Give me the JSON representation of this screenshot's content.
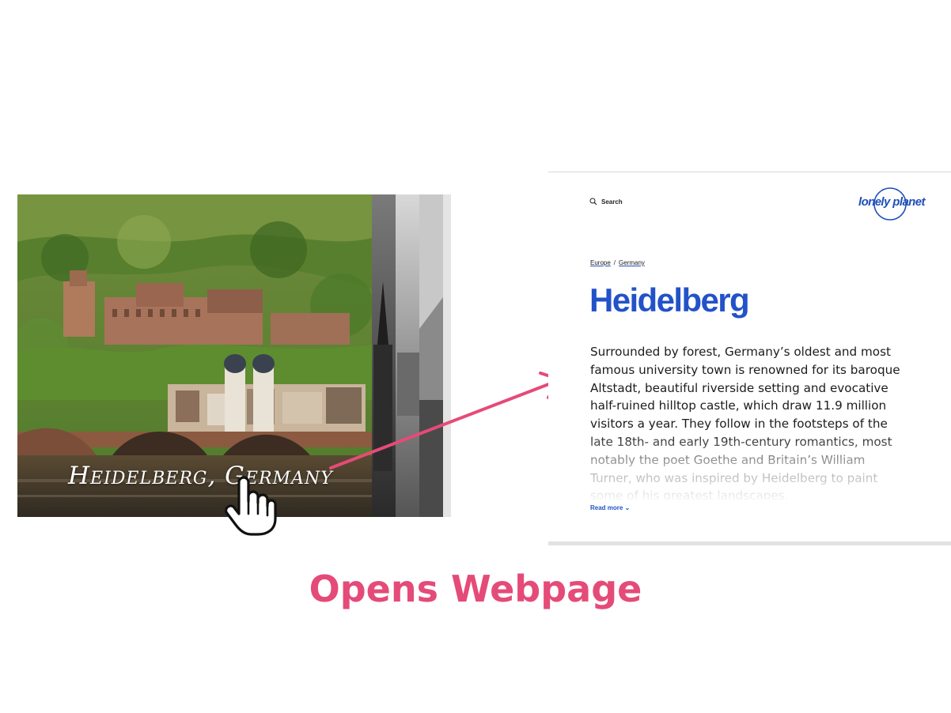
{
  "photo": {
    "caption": "Heidelberg, Germany"
  },
  "webpage": {
    "search_label": "Search",
    "logo_text": "lonely planet",
    "breadcrumb": [
      "Europe",
      "Germany"
    ],
    "breadcrumb_separator": "/",
    "title": "Heidelberg",
    "intro": "Surrounded by forest, Germany’s oldest and most famous university town is renowned for its baroque Altstadt, beautiful riverside setting and evocative half-ruined hilltop castle, which draw 11.9 million visitors a year. They follow in the footsteps of the late 18th- and early 19th-century romantics, most notably the poet Goethe and Britain’s William Turner, who was inspired by Heidelberg to paint some of his greatest landscapes.",
    "read_more": "Read more ⌄"
  },
  "heading": "Opens Webpage",
  "colors": {
    "accent_pink": "#e54b78",
    "brand_blue": "#2352c8"
  }
}
